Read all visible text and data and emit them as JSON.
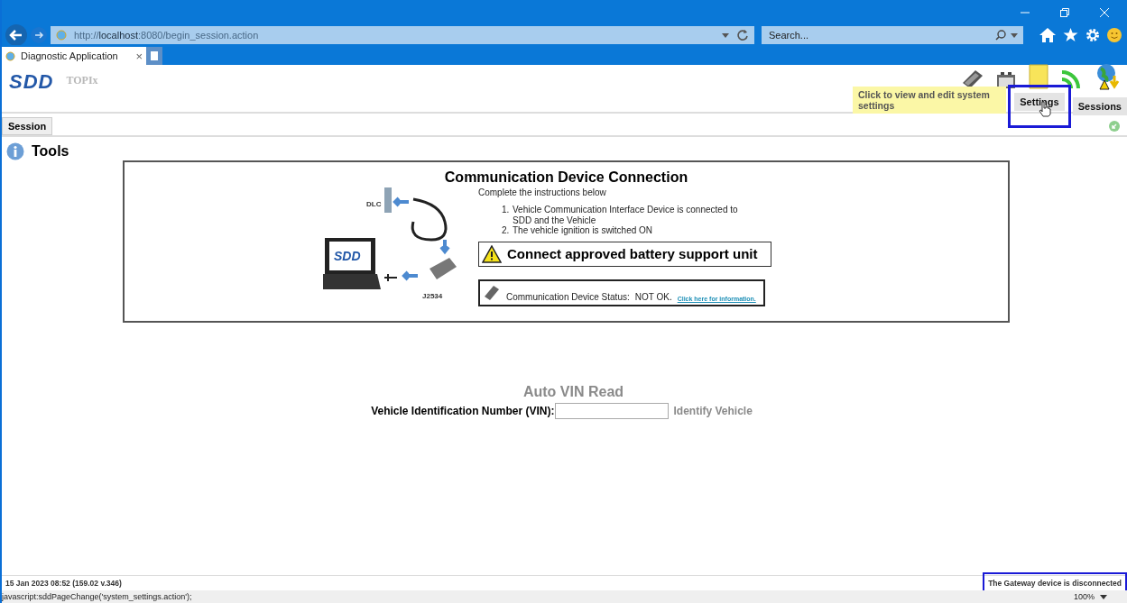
{
  "browser": {
    "url_prefix": "http://",
    "url_host": "localhost",
    "url_rest": ":8080/begin_session.action",
    "search_placeholder": "Search...",
    "tabs": [
      {
        "label": "Diagnostic Application",
        "selected": true
      }
    ],
    "close_glyph": "×"
  },
  "app": {
    "logo": "SDD",
    "product": "TOPIx",
    "tooltip": "Click to view and edit system settings",
    "nav_buttons": [
      {
        "label": "Settings",
        "highlighted": true
      },
      {
        "label": "Sessions",
        "highlighted": false
      }
    ],
    "session_tab": "Session"
  },
  "page": {
    "title": "Tools",
    "panel": {
      "title": "Communication Device Connection",
      "intro": "Complete the instructions below",
      "steps": [
        {
          "number": "1.",
          "text": "Vehicle Communication Interface Device is connected to SDD and the Vehicle"
        },
        {
          "number": "2.",
          "text": "The vehicle ignition is switched ON"
        }
      ],
      "warning": "Connect approved battery support unit",
      "status_label": "Communication Device Status:",
      "status_value": "NOT OK.",
      "status_link": "Click here for information.",
      "diagram_labels": {
        "dlc": "DLC",
        "screen": "SDD",
        "device": "J2534"
      }
    },
    "vin": {
      "heading": "Auto VIN Read",
      "label": "Vehicle Identification Number (VIN):",
      "button": "Identify Vehicle",
      "button_disabled": true
    }
  },
  "footer": {
    "timestamp": "15 Jan 2023 08:52 (159.02 v.346)",
    "gateway_status": "The Gateway device is disconnected",
    "gateway_highlighted": true
  },
  "status_bar": {
    "url": "javascript:sddPageChange('system_settings.action');",
    "zoom": "100%"
  }
}
